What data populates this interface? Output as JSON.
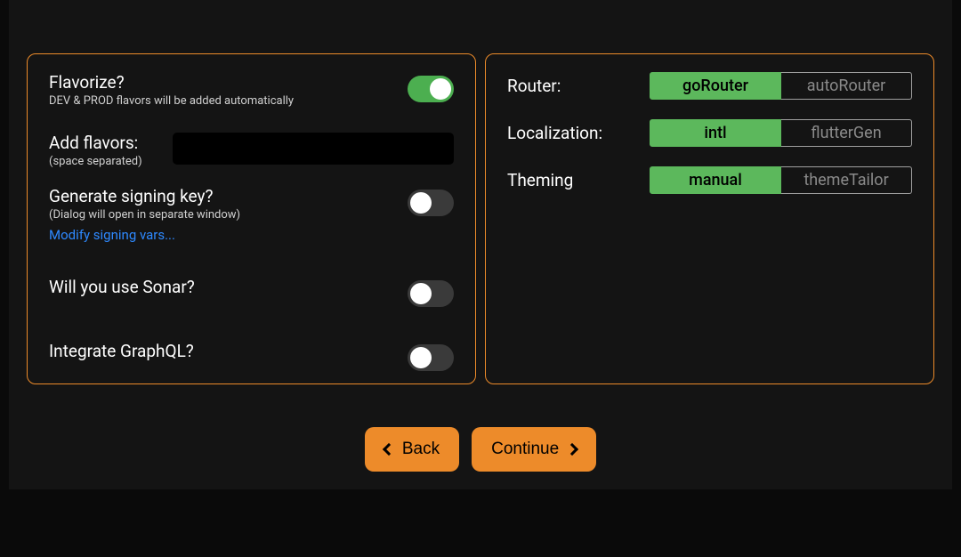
{
  "leftPanel": {
    "flavorize": {
      "title": "Flavorize?",
      "subtitle": "DEV & PROD flavors will be added automatically",
      "enabled": true
    },
    "addFlavors": {
      "title": "Add flavors:",
      "subtitle": "(space separated)",
      "value": ""
    },
    "signingKey": {
      "title": "Generate signing key?",
      "subtitle": "(Dialog will open in separate window)",
      "link": "Modify signing vars...",
      "enabled": false
    },
    "sonar": {
      "title": "Will you use Sonar?",
      "enabled": false
    },
    "graphql": {
      "title": "Integrate GraphQL?",
      "enabled": false
    }
  },
  "rightPanel": {
    "router": {
      "label": "Router:",
      "options": [
        "goRouter",
        "autoRouter"
      ],
      "selectedIndex": 0
    },
    "localization": {
      "label": "Localization:",
      "options": [
        "intl",
        "flutterGen"
      ],
      "selectedIndex": 0
    },
    "theming": {
      "label": "Theming",
      "options": [
        "manual",
        "themeTailor"
      ],
      "selectedIndex": 0
    }
  },
  "buttons": {
    "back": "Back",
    "continue": "Continue"
  }
}
